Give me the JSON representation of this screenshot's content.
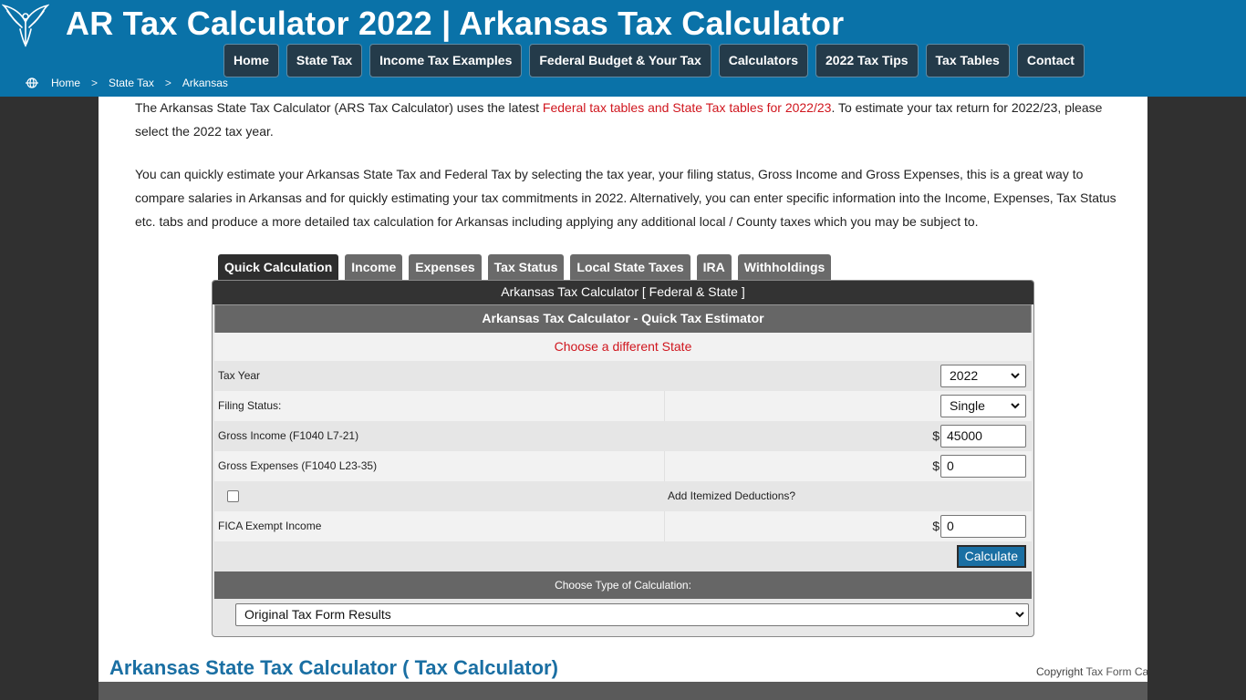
{
  "header": {
    "site_title": "AR Tax Calculator 2022 | Arkansas Tax Calculator",
    "logo_icon": "phoenix-logo-icon",
    "nav": [
      {
        "label": "Home"
      },
      {
        "label": "State Tax"
      },
      {
        "label": "Income Tax Examples"
      },
      {
        "label": "Federal Budget & Your Tax"
      },
      {
        "label": "Calculators"
      },
      {
        "label": "2022 Tax Tips"
      },
      {
        "label": "Tax Tables"
      },
      {
        "label": "Contact"
      }
    ],
    "breadcrumb": {
      "icon": "globe-icon",
      "items": [
        "Home",
        "State Tax",
        "Arkansas"
      ],
      "separator": ">"
    }
  },
  "intro": {
    "p1_before": "The Arkansas State Tax Calculator (ARS Tax Calculator) uses the latest ",
    "p1_link": "Federal tax tables and State Tax tables for 2022/23",
    "p1_after": ". To estimate your tax return for 2022/23, please select the 2022 tax year.",
    "p2": "You can quickly estimate your Arkansas State Tax and Federal Tax by selecting the tax year, your filing status, Gross Income and Gross Expenses, this is a great way to compare salaries in Arkansas and for quickly estimating your tax commitments in 2022. Alternatively, you can enter specific information into the Income, Expenses, Tax Status etc. tabs and produce a more detailed tax calculation for Arkansas including applying any additional local / County taxes which you may be subject to."
  },
  "tabs": [
    {
      "label": "Quick Calculation",
      "active": true
    },
    {
      "label": "Income",
      "active": false
    },
    {
      "label": "Expenses",
      "active": false
    },
    {
      "label": "Tax Status",
      "active": false
    },
    {
      "label": "Local State Taxes",
      "active": false
    },
    {
      "label": "IRA",
      "active": false
    },
    {
      "label": "Withholdings",
      "active": false
    }
  ],
  "calculator": {
    "title": "Arkansas Tax Calculator [ Federal & State ]",
    "subtitle": "Arkansas Tax Calculator - Quick Tax Estimator",
    "choose_state_link": "Choose a different State",
    "tax_year": {
      "label": "Tax Year",
      "value": "2022"
    },
    "filing_status": {
      "label": "Filing Status:",
      "value": "Single"
    },
    "gross_income": {
      "label": "Gross Income (F1040 L7-21)",
      "currency": "$",
      "value": "45000"
    },
    "gross_expenses": {
      "label": "Gross Expenses (F1040 L23-35)",
      "currency": "$",
      "value": "0"
    },
    "itemized": {
      "label": "Add Itemized Deductions?",
      "checked": false
    },
    "fica_exempt": {
      "label": "FICA Exempt Income",
      "currency": "$",
      "value": "0"
    },
    "calculate_label": "Calculate",
    "calc_type_heading": "Choose Type of Calculation:",
    "calc_type_value": "Original Tax Form Results"
  },
  "footer": {
    "section_title": "Arkansas State Tax Calculator ( Tax Calculator)",
    "copyright_prefix": "Copyright ",
    "copyright_link": "Tax Form Calculator"
  },
  "colors": {
    "header_blue": "#0a72a8",
    "nav_button": "#243b4a",
    "link_red": "#d0161e",
    "title_blue": "#1a6fa3"
  }
}
